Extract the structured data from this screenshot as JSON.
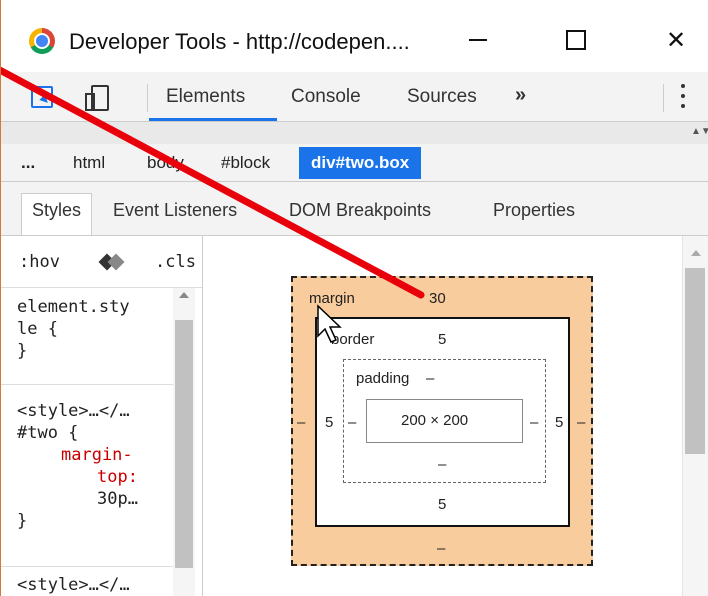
{
  "window": {
    "title": "Developer Tools - http://codepen....",
    "close_glyph": "✕"
  },
  "toolbar": {
    "tabs": [
      "Elements",
      "Console",
      "Sources"
    ],
    "more_glyph": "»"
  },
  "breadcrumb": {
    "ellipsis": "...",
    "items": [
      "html",
      "body",
      "#block"
    ],
    "active": "div#two.box"
  },
  "sidebar_tabs": [
    "Styles",
    "Event Listeners",
    "DOM Breakpoints",
    "Properties"
  ],
  "styles": {
    "filter": {
      "hov": ":hov",
      "cls": ".cls"
    },
    "rule1": {
      "selector_a": "element.sty",
      "selector_b": "le {",
      "close": "}"
    },
    "rule2": {
      "source": "<style>…</…",
      "selector": "#two {",
      "prop_a": "margin-",
      "prop_b": "top:",
      "value": "30p…",
      "close": "}"
    },
    "rule3": {
      "source": "<style>…</…"
    }
  },
  "box_model": {
    "margin": {
      "label": "margin",
      "top": "30",
      "left": "–",
      "right": "–",
      "bottom": "–"
    },
    "border": {
      "label": "border",
      "top": "5",
      "left": "5",
      "right": "5",
      "bottom": "5"
    },
    "padding": {
      "label": "padding",
      "top": "–",
      "left": "–",
      "right": "–",
      "bottom": "–"
    },
    "content": "200 × 200"
  },
  "annotation": {
    "arrow_color": "#e8000b"
  }
}
